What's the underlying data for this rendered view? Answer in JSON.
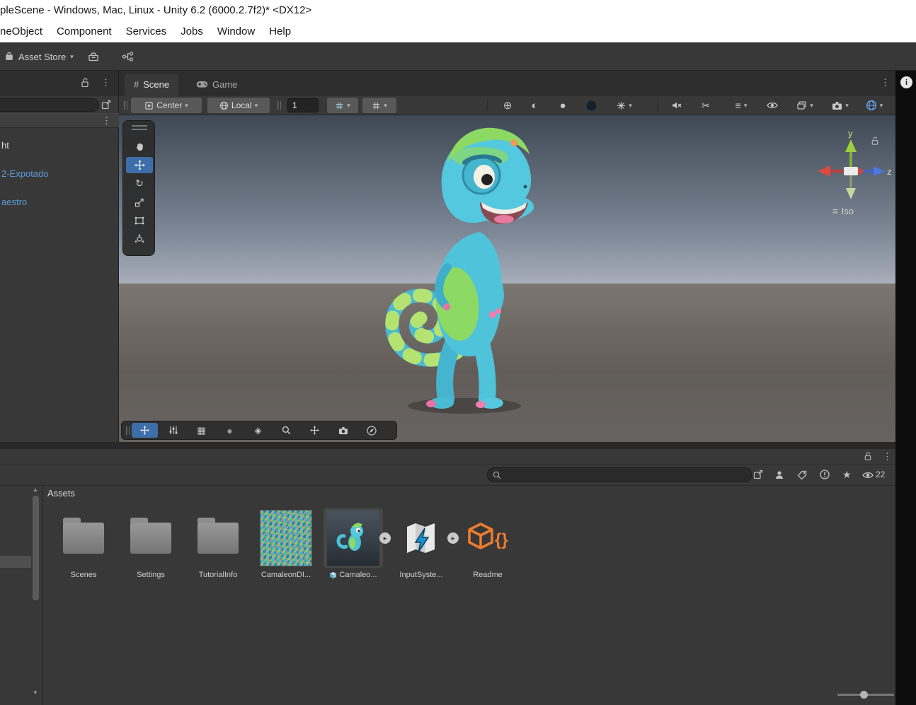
{
  "window": {
    "title": "pleScene - Windows, Mac, Linux - Unity 6.2 (6000.2.7f2)* <DX12>"
  },
  "menubar": {
    "items": [
      "neObject",
      "Component",
      "Services",
      "Jobs",
      "Window",
      "Help"
    ]
  },
  "toolbar": {
    "asset_store": "Asset Store"
  },
  "panels": {
    "scene_tab": "Scene",
    "game_tab": "Game",
    "scene_toolbar": {
      "pivot": "Center",
      "orientation": "Local",
      "grid_size": "1"
    }
  },
  "hierarchy": {
    "items": [
      {
        "label": "ht"
      },
      {
        "label": "2-Expotado"
      },
      {
        "label": "aestro"
      }
    ]
  },
  "viewport": {
    "gizmo": {
      "y": "y",
      "z": "z",
      "mode": "Iso"
    }
  },
  "project": {
    "header": "Assets",
    "hidden_count": "22",
    "search_value": "",
    "assets": [
      {
        "label": "Scenes",
        "type": "folder"
      },
      {
        "label": "Settings",
        "type": "folder"
      },
      {
        "label": "TutorialInfo",
        "type": "folder"
      },
      {
        "label": "CamaleonDI...",
        "type": "texture"
      },
      {
        "label": "Camaleo...",
        "type": "model"
      },
      {
        "label": "InputSyste...",
        "type": "asset"
      },
      {
        "label": "Readme",
        "type": "readme"
      }
    ]
  },
  "glyphs": {
    "caret": "▾",
    "kebab": "⋮",
    "hash": "#",
    "iso_lines": "≡",
    "star": "★",
    "target": "⊕",
    "half_circle": "◐",
    "filled_circle": "●",
    "grid": "▦",
    "diamond": "◈",
    "rect": "▭",
    "rotate": "↻",
    "scissors": "✂",
    "layers": "≡",
    "expander": "▸",
    "info": "i",
    "up": "▲",
    "down": "▼",
    "braces": "{}"
  },
  "colors": {
    "accent_blue": "#4596e2",
    "prefab_text": "#5e9ad8",
    "tool_selected": "#3d6ea8"
  }
}
